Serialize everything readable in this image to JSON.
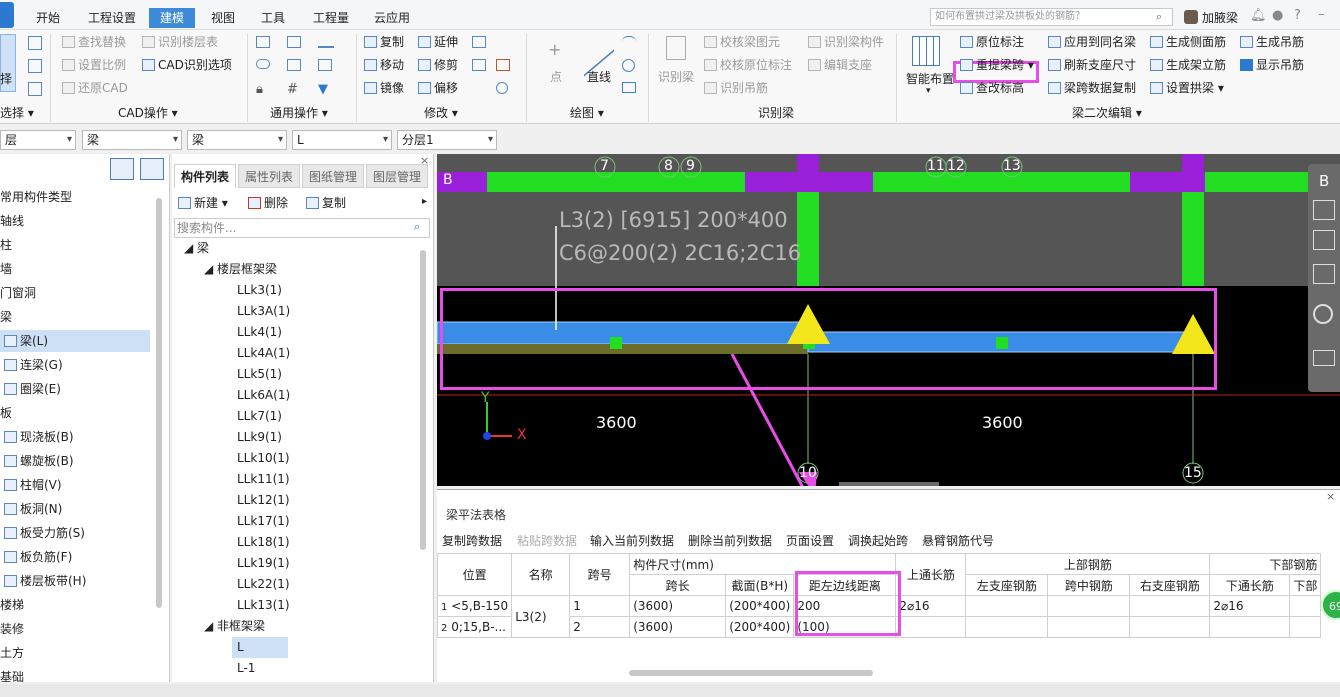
{
  "titlebar": {
    "tabs": [
      "开始",
      "工程设置",
      "建模",
      "视图",
      "工具",
      "工程量",
      "云应用"
    ],
    "active_tab": "建模",
    "search_placeholder": "如何布置拱过梁及拱板处的钢筋？",
    "user": "加腋梁",
    "help": "?"
  },
  "ribbon": {
    "select": {
      "big_label": "择",
      "group": "选择"
    },
    "cad": {
      "items": [
        "查找替换",
        "识别楼层表",
        "设置比例",
        "CAD识别选项",
        "还原CAD"
      ],
      "group": "CAD操作"
    },
    "common": {
      "group": "通用操作"
    },
    "modify": {
      "items": [
        "复制",
        "延伸",
        "移动",
        "修剪",
        "镜像",
        "偏移"
      ],
      "group": "修改"
    },
    "draw": {
      "point": "点",
      "line": "直线",
      "group": "绘图"
    },
    "recognize": {
      "big": "识别梁",
      "items": [
        "校核梁图元",
        "识别梁构件",
        "校核原位标注",
        "编辑支座",
        "识别吊筋"
      ],
      "group": "识别梁"
    },
    "beam_edit": {
      "big": "智能布置",
      "items": [
        "原位标注",
        "应用到同名梁",
        "生成侧面筋",
        "生成吊筋",
        "重提梁跨",
        "刷新支座尺寸",
        "生成架立筋",
        "显示吊筋",
        "查改标高",
        "梁跨数据复制",
        "设置拱梁"
      ],
      "group": "梁二次编辑"
    }
  },
  "filters": [
    "层",
    "梁",
    "梁",
    "L",
    "分层1"
  ],
  "left_list": {
    "items": [
      "常用构件类型",
      "轴线",
      "柱",
      "墙",
      "门窗洞",
      "梁",
      "梁(L)",
      "连梁(G)",
      "圈梁(E)",
      "板",
      "现浇板(B)",
      "螺旋板(B)",
      "柱帽(V)",
      "板洞(N)",
      "板受力筋(S)",
      "板负筋(F)",
      "楼层板带(H)",
      "楼梯",
      "装修",
      "土方",
      "基础"
    ],
    "selected": "梁(L)"
  },
  "mid_panel": {
    "tabs": [
      "构件列表",
      "属性列表",
      "图纸管理",
      "图层管理"
    ],
    "new": "新建",
    "delete": "删除",
    "copy": "复制",
    "search_placeholder": "搜索构件...",
    "root": "梁",
    "group1": "楼层框架梁",
    "beams": [
      "LLk3(1)",
      "LLk3A(1)",
      "LLk4(1)",
      "LLk4A(1)",
      "LLk5(1)",
      "LLk6A(1)",
      "LLk7(1)",
      "LLk9(1)",
      "LLk10(1)",
      "LLk11(1)",
      "LLk12(1)",
      "LLk17(1)",
      "LLk18(1)",
      "LLk19(1)",
      "LLk22(1)",
      "LLk13(1)"
    ],
    "group2": "非框架梁",
    "nonframe": [
      "L",
      "L-1"
    ],
    "selected": "L"
  },
  "canvas": {
    "axis_labels": [
      "7",
      "8",
      "9",
      "11",
      "12",
      "13"
    ],
    "row_label": "B",
    "annotation_line1": "L3(2) [6915] 200*400",
    "annotation_line2": "C6@200(2) 2C16;2C16",
    "dim1": "3600",
    "dim2": "3600",
    "bottom_axis": [
      "10",
      "15"
    ],
    "axis_x": "X",
    "axis_y": "Y",
    "nav_b": "B"
  },
  "table": {
    "title": "梁平法表格",
    "toolbar": [
      "复制跨数据",
      "粘贴跨数据",
      "输入当前列数据",
      "删除当前列数据",
      "页面设置",
      "调换起始跨",
      "悬臂钢筋代号"
    ],
    "headers": {
      "pos": "位置",
      "name": "名称",
      "span": "跨号",
      "size_group": "构件尺寸(mm)",
      "span_len": "跨长",
      "section": "截面(B*H)",
      "dist": "距左边线距离",
      "top_through": "上通长筋",
      "top_group": "上部钢筋",
      "left_seat": "左支座钢筋",
      "mid": "跨中钢筋",
      "right_seat": "右支座钢筋",
      "bottom_group": "下部钢筋",
      "bottom_through": "下通长筋",
      "bottom_more": "下部"
    },
    "rows": [
      {
        "no": "1",
        "pos": "<5,B-150",
        "name": "L3(2)",
        "span": "1",
        "len": "(3600)",
        "section": "(200*400)",
        "dist": "200",
        "top": "2⌀16",
        "bottom": "2⌀16"
      },
      {
        "no": "2",
        "pos": "0;15,B-...",
        "name": "",
        "span": "2",
        "len": "(3600)",
        "section": "(200*400)",
        "dist": "(100)",
        "top": "",
        "bottom": ""
      }
    ]
  },
  "badge": "69",
  "colors": {
    "accent": "#3d8ad8",
    "highlight": "#e84de8",
    "beam_green": "#22dd22",
    "beam_purple": "#9a1fd9",
    "beam_blue": "#3a8de6"
  }
}
